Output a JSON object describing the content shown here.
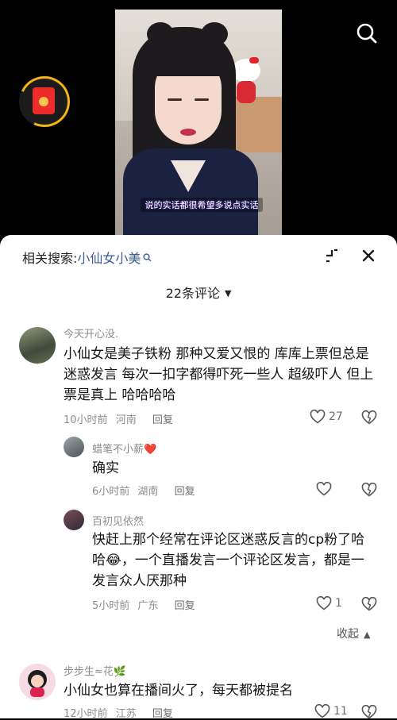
{
  "video": {
    "caption": "说的实话都很希望多说点实话"
  },
  "sheet": {
    "related_prefix": "相关搜索:",
    "related_query": "小仙女小美",
    "count_label": "22条评论"
  },
  "comments": [
    {
      "username": "今天开心没.",
      "text": "小仙女是美子铁粉 那种又爱又恨的 库库上票但总是迷惑发言 每次一扣字都得吓死一些人 超级吓人 但上票是真上 哈哈哈哈",
      "time": "10小时前",
      "location": "河南",
      "reply_label": "回复",
      "likes": "27"
    },
    {
      "username": "蜡笔不小薪❤️",
      "text": "确实",
      "time": "6小时前",
      "location": "湖南",
      "reply_label": "回复",
      "likes": ""
    },
    {
      "username": "百初见依然",
      "text": "快赶上那个经常在评论区迷惑反言的cp粉了哈哈😂，一个直播发言一个评论区发言，都是一发言众人厌那种",
      "time": "5小时前",
      "location": "广东",
      "reply_label": "回复",
      "likes": "1"
    },
    {
      "username": "步步生≈花🌿",
      "text": "小仙女也算在播间火了，每天都被提名",
      "time": "12小时前",
      "location": "江苏",
      "reply_label": "回复",
      "likes": "11"
    }
  ],
  "collapse_label": "收起",
  "colors": {
    "link_blue": "#3b5a96",
    "meta_gray": "#8d8d8d"
  }
}
